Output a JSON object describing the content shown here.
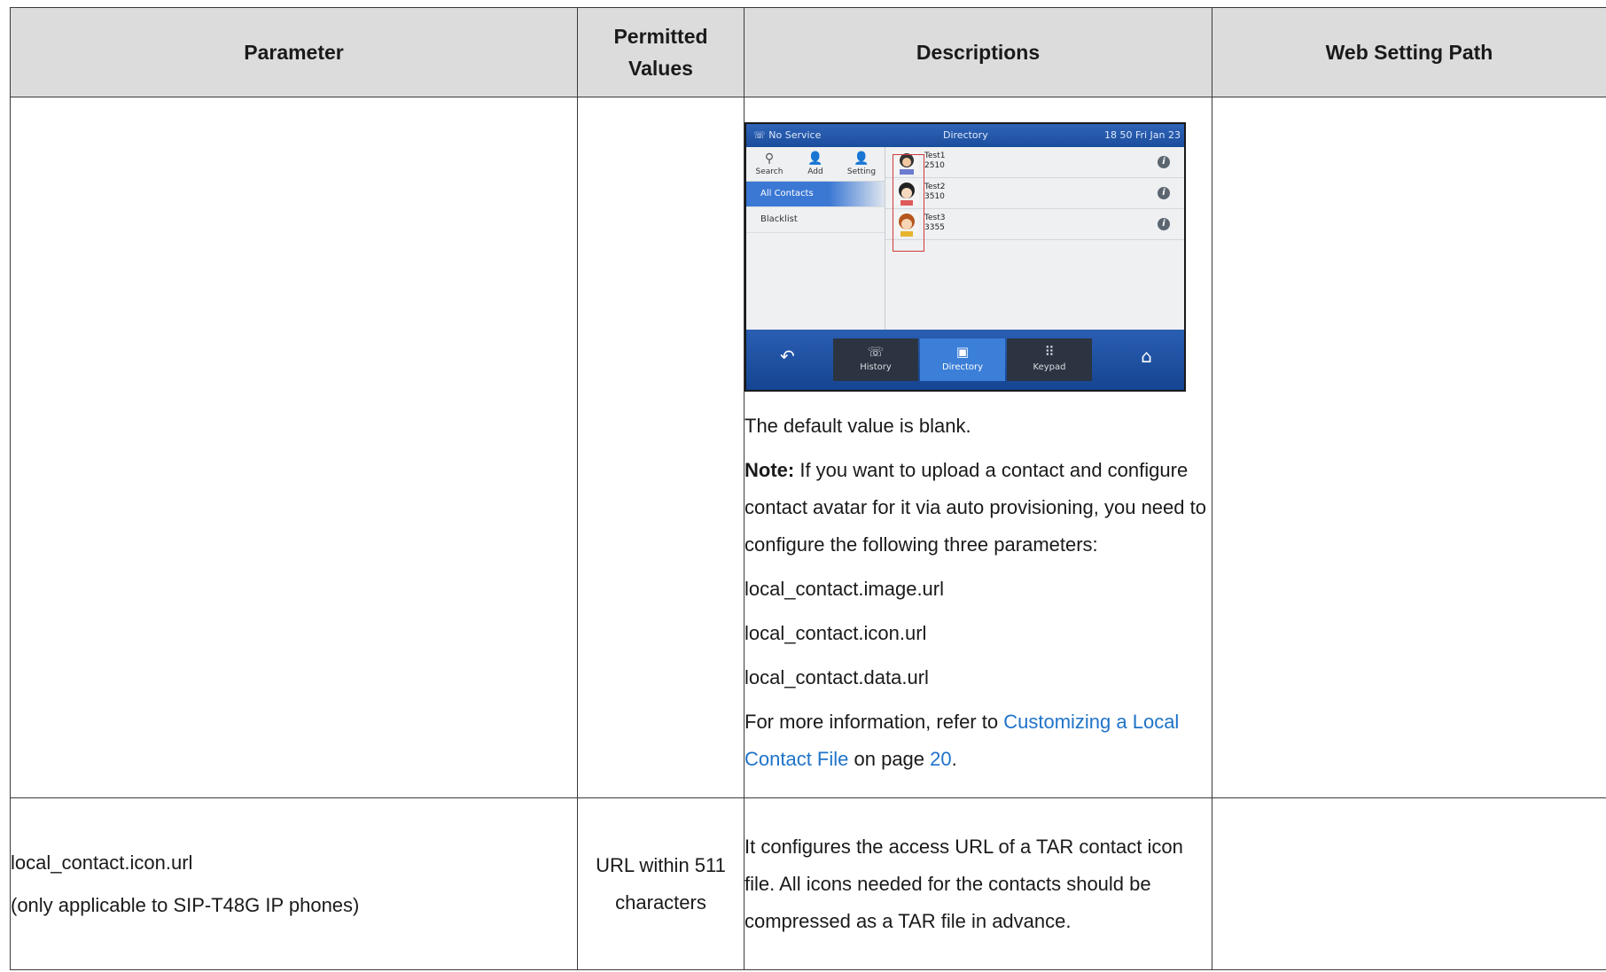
{
  "table": {
    "headers": [
      "Parameter",
      "Permitted Values",
      "Descriptions",
      "Web Setting Path"
    ],
    "row1": {
      "parameter": "",
      "permitted": "",
      "web_path": "",
      "desc_default": "The default value is blank.",
      "desc_note_label": "Note:",
      "desc_note_text": " If you want to upload a contact and configure contact avatar for it via auto provisioning, you need to configure the following three parameters:",
      "desc_params": [
        "local_contact.image.url",
        "local_contact.icon.url",
        "local_contact.data.url"
      ],
      "desc_ref_prefix": "For more information, refer to ",
      "desc_ref_link": "Customizing a Local Contact File",
      "desc_ref_mid": " on page ",
      "desc_ref_page": "20",
      "desc_ref_end": "."
    },
    "row2": {
      "parameter_lines": [
        "local_contact.icon.url",
        "(only applicable to SIP-T48G IP phones)"
      ],
      "permitted": "URL within 511 characters",
      "description": "It configures the access URL of a TAR contact icon file. All icons needed for the contacts should be compressed as a TAR file in advance.",
      "web_path": ""
    }
  },
  "phone_screen": {
    "status_left": "No Service",
    "status_center": "Directory",
    "status_right": "18 50 Fri Jan 23",
    "tools": [
      "Search",
      "Add",
      "Setting"
    ],
    "groups": [
      "All Contacts",
      "Blacklist"
    ],
    "contacts": [
      {
        "name": "Test1",
        "number": "2510"
      },
      {
        "name": "Test2",
        "number": "3510"
      },
      {
        "name": "Test3",
        "number": "3355"
      }
    ],
    "bottom_buttons": [
      "History",
      "Directory",
      "Keypad"
    ]
  }
}
